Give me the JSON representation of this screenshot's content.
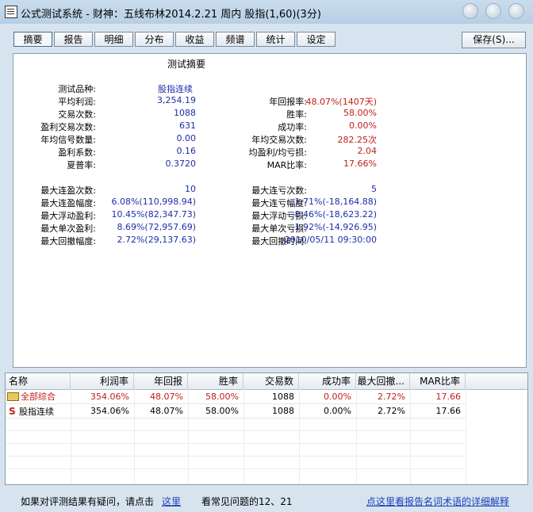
{
  "window": {
    "title": "公式测试系统 - 财神：五线布林2014.2.21 周内 股指(1,60)(3分)"
  },
  "tabs": [
    "摘要",
    "报告",
    "明细",
    "分布",
    "收益",
    "频谱",
    "统计",
    "设定"
  ],
  "active_tab": "摘要",
  "save_label": "保存(S)...",
  "summary": {
    "title": "测试摘要",
    "block1_left": [
      {
        "label": "测试品种:",
        "value": "股指连续"
      },
      {
        "label": "平均利润:",
        "value": "3,254.19"
      },
      {
        "label": "交易次数:",
        "value": "1088"
      },
      {
        "label": "盈利交易次数:",
        "value": "631"
      },
      {
        "label": "年均信号数量:",
        "value": "0.00"
      },
      {
        "label": "盈利系数:",
        "value": "0.16"
      },
      {
        "label": "夏普率:",
        "value": "0.3720"
      }
    ],
    "block1_right": [
      {
        "label": "年回报率:",
        "value": "48.07%(1407天)"
      },
      {
        "label": "胜率:",
        "value": "58.00%"
      },
      {
        "label": "成功率:",
        "value": "0.00%"
      },
      {
        "label": "年均交易次数:",
        "value": "282.25次"
      },
      {
        "label": "均盈利/均亏损:",
        "value": "2.04"
      },
      {
        "label": "MAR比率:",
        "value": "17.66%"
      }
    ],
    "block2_left": [
      {
        "label": "最大连盈次数:",
        "value": "10"
      },
      {
        "label": "最大连盈幅度:",
        "value": "6.08%(110,998.94)"
      },
      {
        "label": "最大浮动盈利:",
        "value": "10.45%(82,347.73)"
      },
      {
        "label": "最大单次盈利:",
        "value": "8.69%(72,957.69)"
      },
      {
        "label": "最大回撤幅度:",
        "value": "2.72%(29,137.63)"
      }
    ],
    "block2_right": [
      {
        "label": "最大连亏次数:",
        "value": "5"
      },
      {
        "label": "最大连亏幅度:",
        "value": "-1.71%(-18,164.88)"
      },
      {
        "label": "最大浮动亏损:",
        "value": "-8.46%(-18,623.22)"
      },
      {
        "label": "最大单次亏损:",
        "value": "-1.92%(-14,926.95)"
      },
      {
        "label": "最大回撤时间:",
        "value": "2010/05/11 09:30:00"
      }
    ]
  },
  "results_table": {
    "headers": [
      "名称",
      "利润率",
      "年回报",
      "胜率",
      "交易数",
      "成功率",
      "最大回撤...",
      "MAR比率"
    ],
    "rows": [
      {
        "icon": "folder-icon",
        "name": "全部综合",
        "values": [
          "354.06%",
          "48.07%",
          "58.00%",
          "1088",
          "0.00%",
          "2.72%",
          "17.66"
        ]
      },
      {
        "icon": "s-letter-icon",
        "name": "股指连续",
        "values": [
          "354.06%",
          "48.07%",
          "58.00%",
          "1088",
          "0.00%",
          "2.72%",
          "17.66"
        ]
      }
    ]
  },
  "footer": {
    "question_text": "如果对评测结果有疑问，请点击",
    "here_link": "这里",
    "faq_text": "看常见问题的12、21",
    "glossary_link": "点这里看报告名词术语的详细解释"
  },
  "colors": {
    "label": "#000000",
    "value_blue": "#1c2fa8",
    "value_red": "#c0201c",
    "background": "#d7e4ef"
  }
}
